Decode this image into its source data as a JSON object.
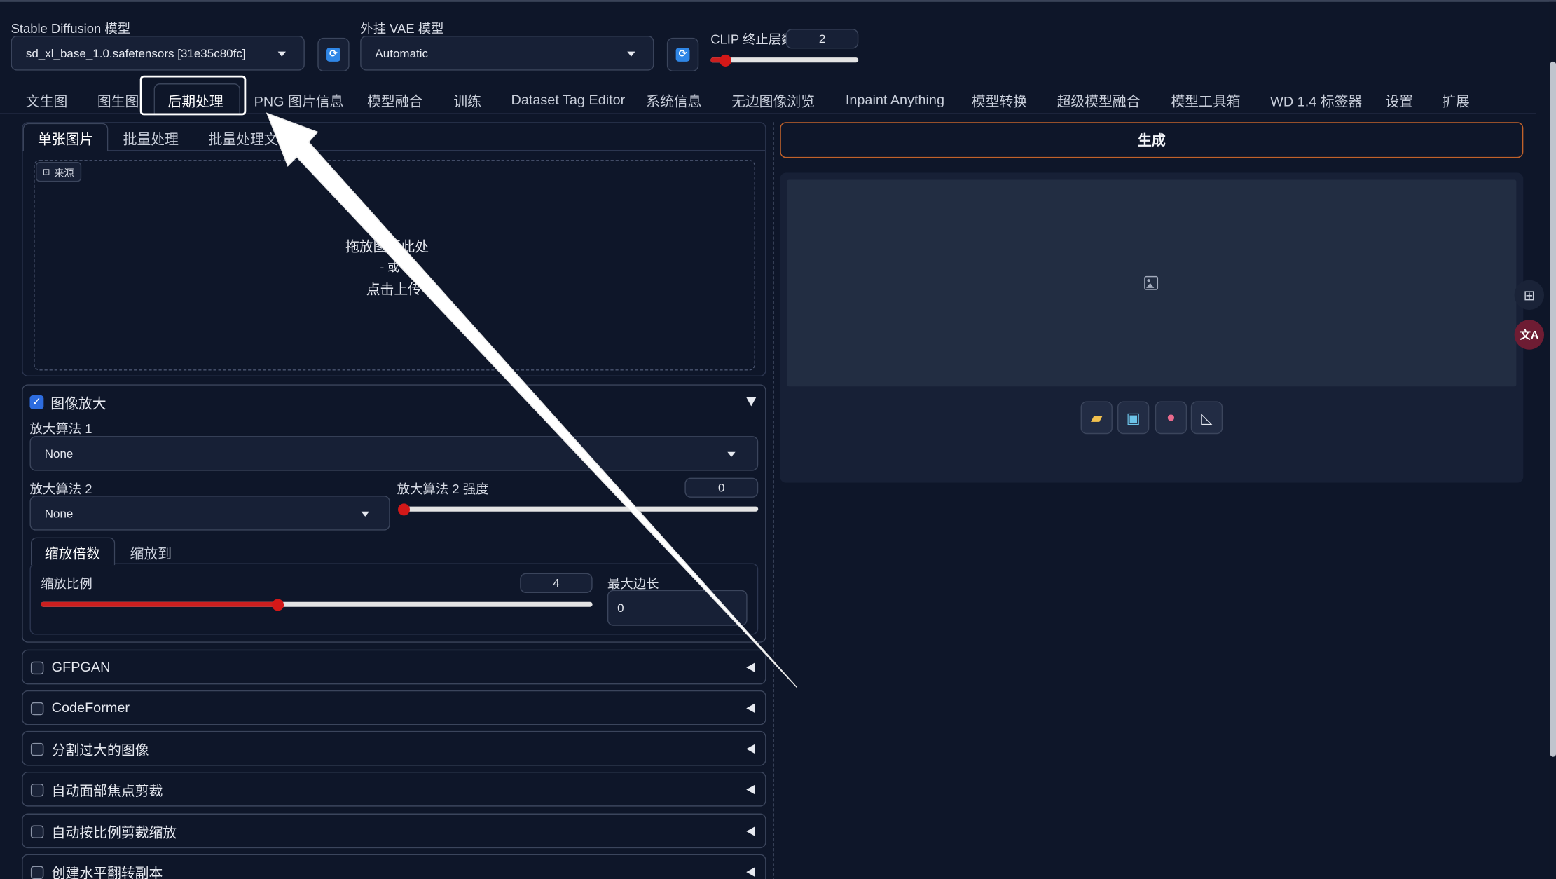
{
  "header": {
    "sd_model_label": "Stable Diffusion 模型",
    "sd_model_value": "sd_xl_base_1.0.safetensors [31e35c80fc]",
    "vae_label": "外挂 VAE 模型",
    "vae_value": "Automatic",
    "clip_label": "CLIP 终止层数",
    "clip_value": "2",
    "clip_progress": 0.1
  },
  "tabs": [
    {
      "label": "文生图"
    },
    {
      "label": "图生图"
    },
    {
      "label": "后期处理"
    },
    {
      "label": "PNG 图片信息"
    },
    {
      "label": "模型融合"
    },
    {
      "label": "训练"
    },
    {
      "label": "Dataset Tag Editor"
    },
    {
      "label": "系统信息"
    },
    {
      "label": "无边图像浏览"
    },
    {
      "label": "Inpaint Anything"
    },
    {
      "label": "模型转换"
    },
    {
      "label": "超级模型融合"
    },
    {
      "label": "模型工具箱"
    },
    {
      "label": "WD 1.4 标签器"
    },
    {
      "label": "设置"
    },
    {
      "label": "扩展"
    }
  ],
  "subtabs": [
    "单张图片",
    "批量处理",
    "批量处理文"
  ],
  "upload": {
    "source_label": "来源",
    "line1": "拖放图",
    "line1b": "至此处",
    "line2": "- 或",
    "line3": "点击上传"
  },
  "upscale": {
    "title": "图像放大",
    "algo1_label": "放大算法 1",
    "algo1_value": "None",
    "algo2_label": "放大算法 2",
    "algo2_value": "None",
    "algo2_strength_label": "放大算法 2 强度",
    "algo2_strength_value": "0",
    "algo2_strength_fraction": 0.0,
    "tab_scale_by": "缩放倍数",
    "tab_scale_to": "缩放到",
    "scale_label": "缩放比例",
    "scale_value": "4",
    "scale_fraction": 0.43,
    "max_side_label": "最大边长",
    "max_side_value": "0"
  },
  "accordions": [
    "GFPGAN",
    "CodeFormer",
    "分割过大的图像",
    "自动面部焦点剪裁",
    "自动按比例剪裁缩放",
    "创建水平翻转副本"
  ],
  "generate_label": "生成",
  "tools": [
    "folder-icon",
    "image-icon",
    "palette-icon",
    "ruler-icon"
  ],
  "side_float_icons": [
    "grid-plus-icon",
    "translate-icon"
  ],
  "colors": {
    "accent": "#cc1f1f",
    "generate_border": "#c2622a",
    "annotation": "#ffffff"
  }
}
